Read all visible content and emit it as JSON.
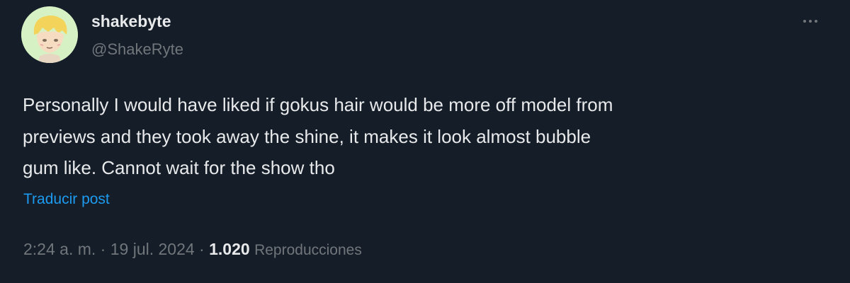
{
  "user": {
    "display_name": "shakebyte",
    "handle": "@ShakeRyte",
    "avatar_icon": "cartoon-face-avatar"
  },
  "more_icon": "ellipsis-icon",
  "post": {
    "lines": [
      "Personally I would have liked if gokus hair would be more off model from",
      "previews and they took away the shine, it makes it look almost bubble",
      "gum like. Cannot wait for the show tho"
    ],
    "translate_label": "Traducir post"
  },
  "meta": {
    "time": "2:24 a. m.",
    "sep1": " · ",
    "date": "19 jul. 2024",
    "sep2": " · ",
    "views_count": "1.020",
    "views_label": "Reproducciones"
  },
  "colors": {
    "background": "#151d29",
    "text": "#e7e9ea",
    "secondary": "#71767b",
    "link": "#1d9bf0"
  }
}
